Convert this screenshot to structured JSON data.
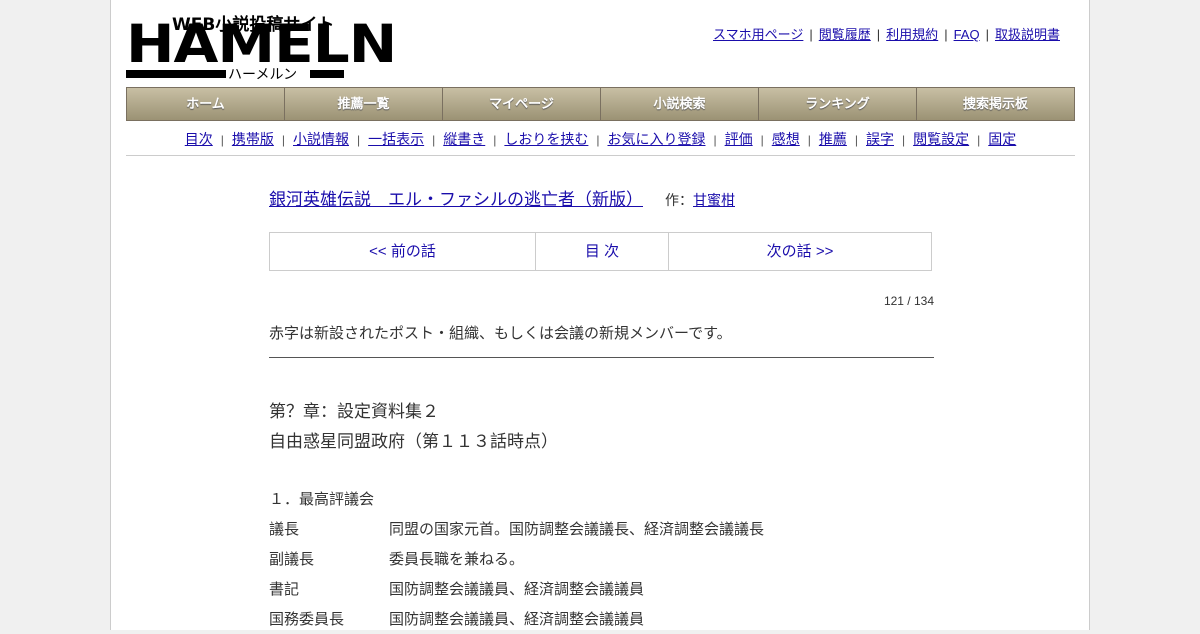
{
  "logo": {
    "tagline": "WEB小説投稿サイト",
    "main": "HAMELN",
    "kana": "ハーメルン"
  },
  "top_links": [
    "スマホ用ページ",
    "閲覧履歴",
    "利用規約",
    "FAQ",
    "取扱説明書"
  ],
  "main_nav": [
    "ホーム",
    "推薦一覧",
    "マイページ",
    "小説検索",
    "ランキング",
    "捜索掲示板"
  ],
  "sub_nav": [
    "目次",
    "携帯版",
    "小説情報",
    "一括表示",
    "縦書き",
    "しおりを挟む",
    "お気に入り登録",
    "評価",
    "感想",
    "推薦",
    "誤字",
    "閲覧設定",
    "固定"
  ],
  "novel": {
    "title": "銀河英雄伝説　エル・ファシルの逃亡者（新版）",
    "author_prefix": "作：",
    "author": "甘蜜柑"
  },
  "chapter_nav": {
    "prev": "<< 前の話",
    "toc": "目 次",
    "next": "次の話 >>"
  },
  "page_count": "121 / 134",
  "preface": "赤字は新設されたポスト・組織、もしくは会議の新規メンバーです。",
  "chapter": {
    "line1": "第？章：設定資料集２",
    "line2": "自由惑星同盟政府（第１１３話時点）"
  },
  "body": {
    "section_heading": "１．最高評議会",
    "rows": [
      {
        "term": "議長",
        "desc": "同盟の国家元首。国防調整会議議長、経済調整会議議長"
      },
      {
        "term": "副議長",
        "desc": "委員長職を兼ねる。"
      },
      {
        "term": "書記",
        "desc": "国防調整会議議員、経済調整会議議員"
      },
      {
        "term": "国務委員長",
        "desc": "国防調整会議議員、経済調整会議議員"
      }
    ]
  }
}
